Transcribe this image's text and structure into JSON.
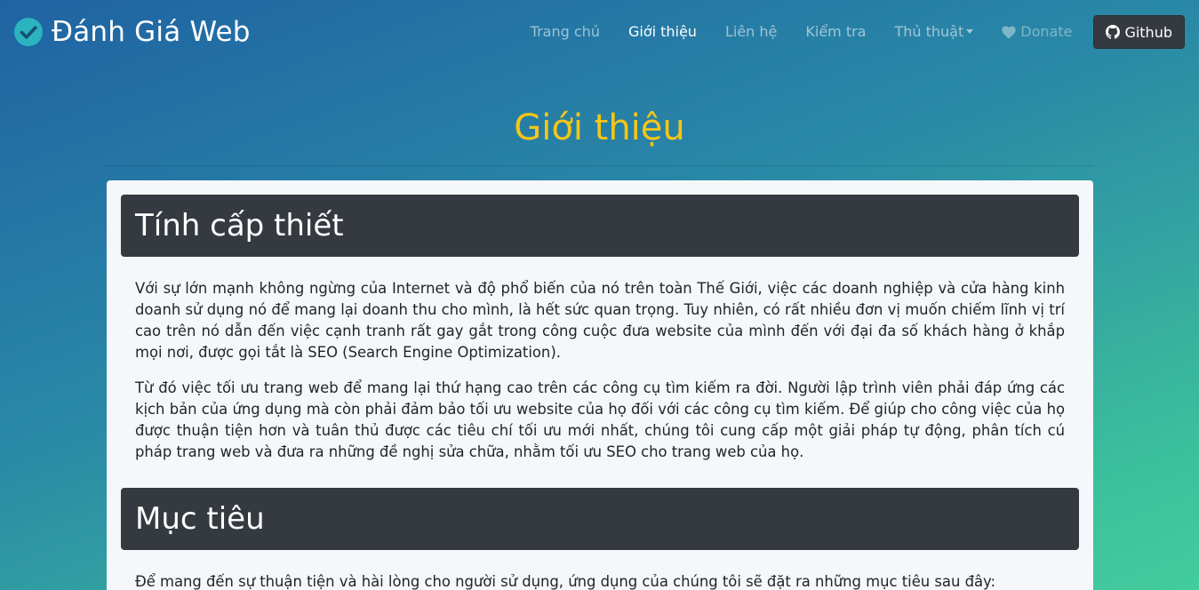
{
  "navbar": {
    "brand": "Đánh Giá Web",
    "brand_icon": "check-circle-icon",
    "items": [
      {
        "label": "Trang chủ"
      },
      {
        "label": "Giới thiệu",
        "active": true
      },
      {
        "label": "Liên hệ"
      },
      {
        "label": "Kiểm tra"
      },
      {
        "label": "Thủ thuật",
        "dropdown": true
      }
    ],
    "donate": {
      "label": "Donate",
      "icon": "heart-icon"
    },
    "github": {
      "label": "Github",
      "icon": "github-icon"
    }
  },
  "page": {
    "title": "Giới thiệu",
    "title_color": "#f5c518"
  },
  "sections": [
    {
      "heading": "Tính cấp thiết",
      "paragraphs": [
        "Với sự lớn mạnh không ngừng của Internet và độ phổ biến của nó trên toàn Thế Giới, việc các doanh nghiệp và cửa hàng kinh doanh sử dụng nó để mang lại doanh thu cho mình, là hết sức quan trọng. Tuy nhiên, có rất nhiều đơn vị muốn chiếm lĩnh vị trí cao trên nó dẫn đến việc cạnh tranh rất gay gắt trong công cuộc đưa website của mình đến với đại đa số khách hàng ở khắp mọi nơi, được gọi tắt là SEO (Search Engine Optimization).",
        "Từ đó việc tối ưu trang web để mang lại thứ hạng cao trên các công cụ tìm kiếm ra đời. Người lập trình viên phải đáp ứng các kịch bản của ứng dụng mà còn phải đảm bảo tối ưu website của họ đối với các công cụ tìm kiếm. Để giúp cho công việc của họ được thuận tiện hơn và tuân thủ được các tiêu chí tối ưu mới nhất, chúng tôi cung cấp một giải pháp tự động, phân tích cú pháp trang web và đưa ra những đề nghị sửa chữa, nhằm tối ưu SEO cho trang web của họ."
      ]
    },
    {
      "heading": "Mục tiêu",
      "paragraphs": [
        "Để mang đến sự thuận tiện và hài lòng cho người sử dụng, ứng dụng của chúng tôi sẽ đặt ra những mục tiêu sau đây:"
      ]
    }
  ]
}
